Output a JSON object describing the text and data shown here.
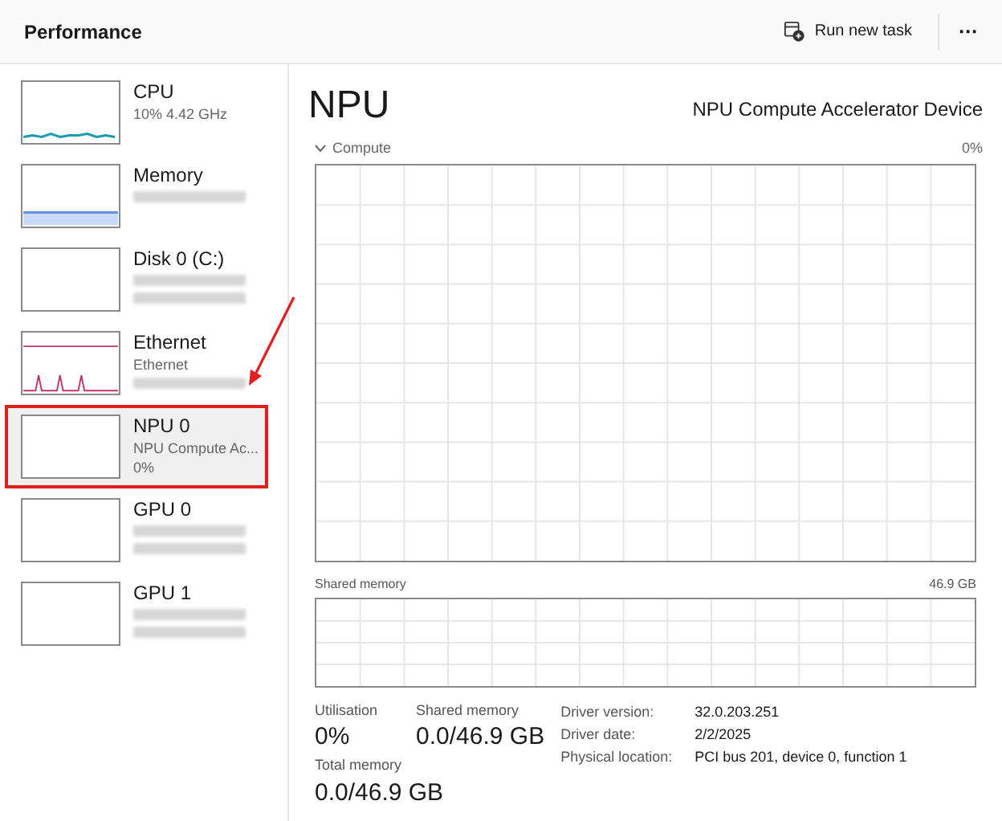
{
  "header": {
    "title": "Performance",
    "run_task": "Run new task",
    "more": "···"
  },
  "sidebar": {
    "items": [
      {
        "name": "CPU",
        "kind": "line",
        "color": "#1a9bb0",
        "lines": [
          {
            "kind": "text",
            "text": "10%  4.42 GHz"
          }
        ],
        "selected": false,
        "annotated": false
      },
      {
        "name": "Memory",
        "kind": "fill",
        "color": "#5b8fe0",
        "lines": [
          {
            "kind": "blurred"
          }
        ],
        "selected": false,
        "annotated": false
      },
      {
        "name": "Disk 0 (C:)",
        "kind": "empty",
        "lines": [
          {
            "kind": "blurred"
          },
          {
            "kind": "blurred"
          }
        ],
        "selected": false,
        "annotated": false
      },
      {
        "name": "Ethernet",
        "kind": "spikes",
        "color": "#c2346b",
        "lines": [
          {
            "kind": "text",
            "text": "Ethernet"
          },
          {
            "kind": "blurred"
          }
        ],
        "selected": false,
        "annotated": false
      },
      {
        "name": "NPU 0",
        "kind": "empty",
        "lines": [
          {
            "kind": "text",
            "text": "NPU Compute Ac..."
          },
          {
            "kind": "text",
            "text": "0%"
          }
        ],
        "selected": true,
        "annotated": true
      },
      {
        "name": "GPU 0",
        "kind": "empty",
        "lines": [
          {
            "kind": "blurred"
          },
          {
            "kind": "blurred"
          }
        ],
        "selected": false,
        "annotated": false
      },
      {
        "name": "GPU 1",
        "kind": "empty",
        "lines": [
          {
            "kind": "blurred"
          },
          {
            "kind": "blurred"
          }
        ],
        "selected": false,
        "annotated": false
      }
    ]
  },
  "main": {
    "title": "NPU",
    "device": "NPU Compute Accelerator Device",
    "compute": {
      "label": "Compute",
      "value": "0%"
    },
    "shared_graph": {
      "label": "Shared memory",
      "value": "46.9 GB"
    },
    "stats": [
      {
        "label": "Utilisation",
        "value": "0%"
      },
      {
        "label": "Shared memory",
        "value": "0.0/46.9 GB"
      },
      {
        "label": "Total memory",
        "value": "0.0/46.9 GB"
      }
    ],
    "details": [
      {
        "label": "Driver version:",
        "value": "32.0.203.251"
      },
      {
        "label": "Driver date:",
        "value": "2/2/2025"
      },
      {
        "label": "Physical location:",
        "value": "PCI bus 201, device 0, function 1"
      }
    ]
  }
}
